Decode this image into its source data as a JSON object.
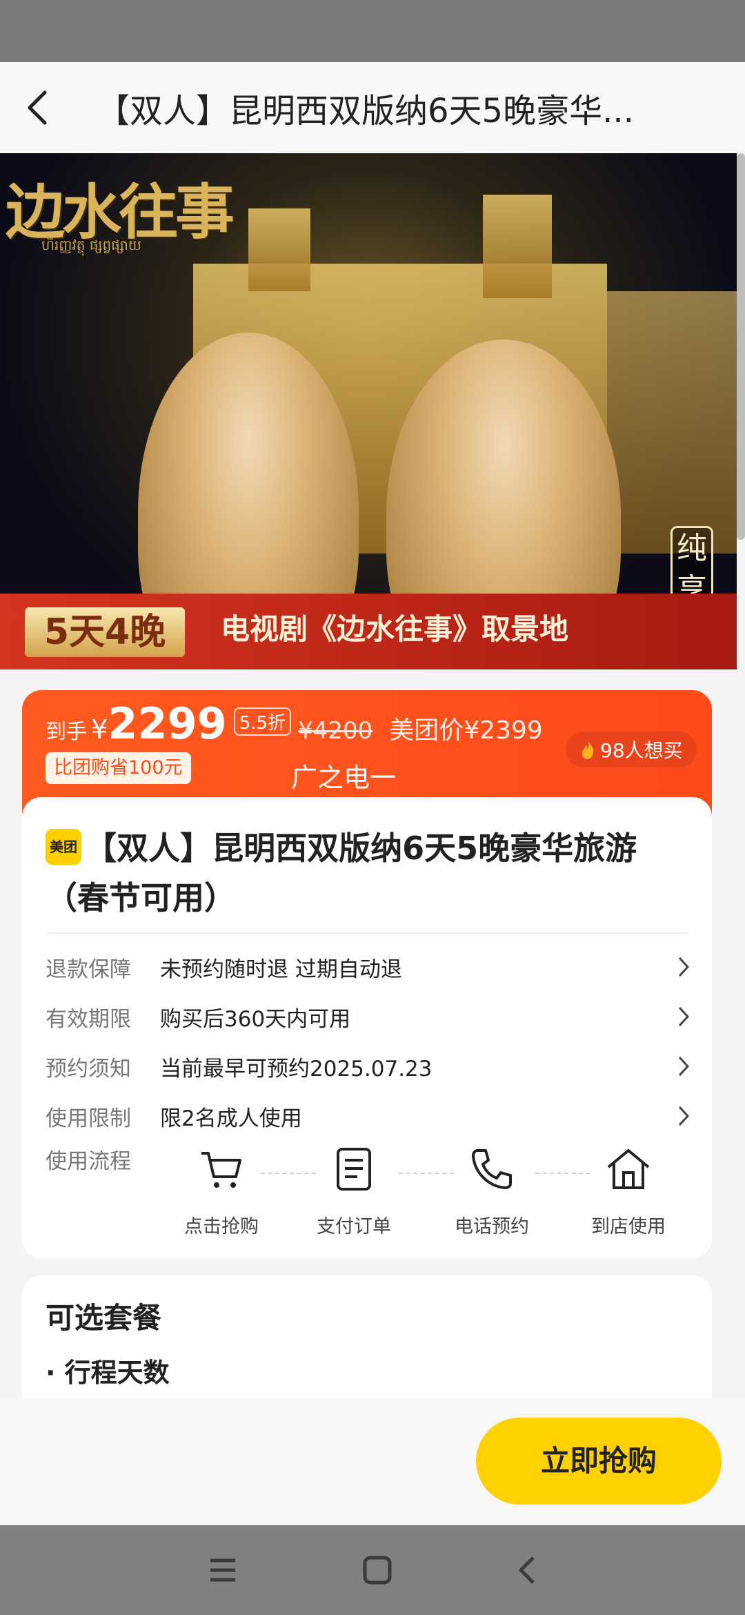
{
  "header": {
    "title": "【双人】昆明西双版纳6天5晚豪华..."
  },
  "banner": {
    "logo_text": "边水往事",
    "logo_sub": "ហិរញ្ញវត្ថុ ផ្សព្វផ្សាយ",
    "side_tag": "纯享",
    "days_badge": "5天4晚",
    "ribbon_text": "电视剧《边水往事》取景地"
  },
  "price": {
    "label": "到手",
    "currency": "¥",
    "value": "2299",
    "discount": "5.5折",
    "original": "¥4200",
    "meituan_price": "美团价¥2399",
    "save_tag": "比团购省100元",
    "overlay_text": "广之电一",
    "want_count": "98人想买"
  },
  "product": {
    "brand": "美团",
    "title": "【双人】昆明西双版纳6天5晚豪华旅游（春节可用）"
  },
  "info": [
    {
      "label": "退款保障",
      "value": "未预约随时退 过期自动退"
    },
    {
      "label": "有效期限",
      "value": "购买后360天内可用"
    },
    {
      "label": "预约须知",
      "value": "当前最早可预约2025.07.23"
    },
    {
      "label": "使用限制",
      "value": "限2名成人使用"
    }
  ],
  "flow": {
    "label": "使用流程",
    "steps": [
      {
        "icon": "cart-icon",
        "text": "点击抢购"
      },
      {
        "icon": "document-icon",
        "text": "支付订单"
      },
      {
        "icon": "phone-icon",
        "text": "电话预约"
      },
      {
        "icon": "home-icon",
        "text": "到店使用"
      }
    ]
  },
  "packages": {
    "title": "可选套餐",
    "subtitle": "· 行程天数"
  },
  "buy_button": "立即抢购",
  "colors": {
    "accent": "#ff4a1a",
    "button": "#ffd100"
  }
}
